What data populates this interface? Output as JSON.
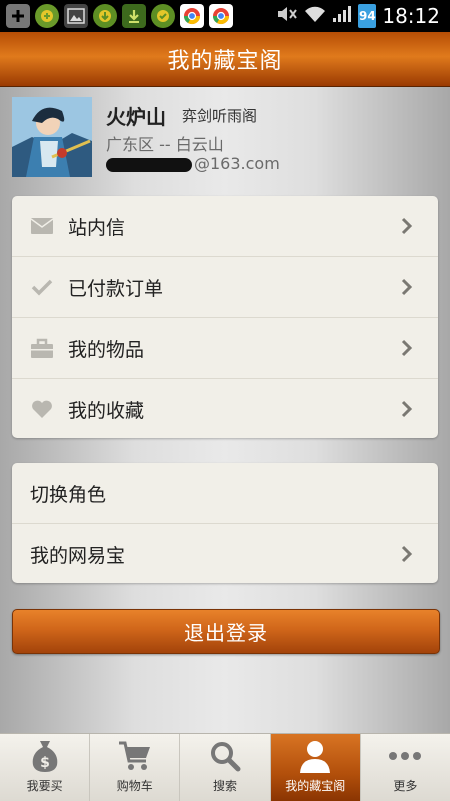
{
  "status_bar": {
    "time": "18:12",
    "battery": "94"
  },
  "header": {
    "title": "我的藏宝阁"
  },
  "profile": {
    "name": "火炉山",
    "server": "弈剑听雨阁",
    "region": "广东区 -- 白云山",
    "email_suffix": "@163.com"
  },
  "menu": [
    {
      "label": "站内信",
      "icon": "mail-icon"
    },
    {
      "label": "已付款订单",
      "icon": "check-icon"
    },
    {
      "label": "我的物品",
      "icon": "bag-icon"
    },
    {
      "label": "我的收藏",
      "icon": "heart-icon"
    }
  ],
  "menu2": [
    {
      "label": "切换角色"
    },
    {
      "label": "我的网易宝"
    }
  ],
  "logout_label": "退出登录",
  "tabs": [
    {
      "label": "我要买",
      "icon": "money-bag-icon"
    },
    {
      "label": "购物车",
      "icon": "cart-icon"
    },
    {
      "label": "搜索",
      "icon": "search-icon"
    },
    {
      "label": "我的藏宝阁",
      "icon": "person-icon",
      "active": true
    },
    {
      "label": "更多",
      "icon": "more-icon"
    }
  ],
  "colors": {
    "accent": "#d0661a",
    "header": "#c2580f",
    "card": "#f1efe8"
  }
}
